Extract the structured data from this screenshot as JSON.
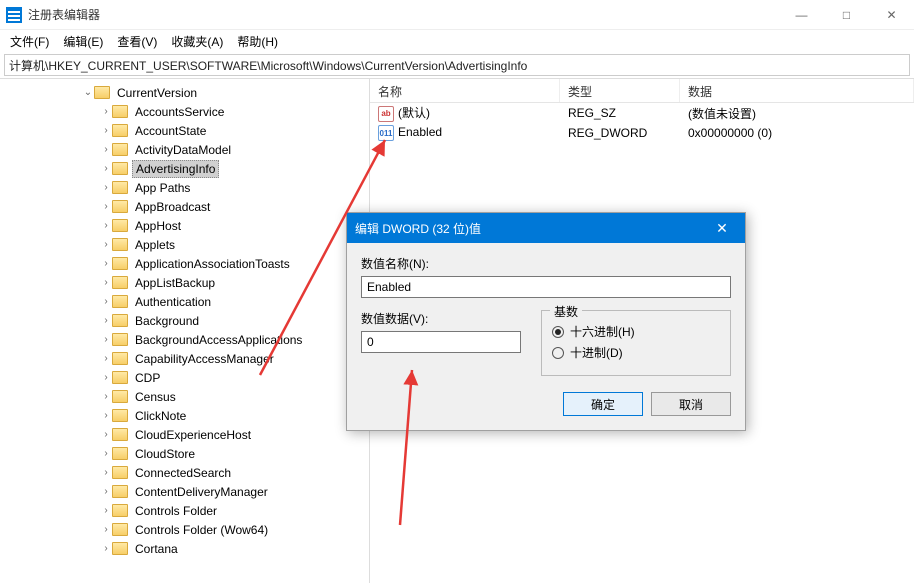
{
  "window": {
    "title": "注册表编辑器"
  },
  "menu": {
    "file": "文件(F)",
    "edit": "编辑(E)",
    "view": "查看(V)",
    "favorites": "收藏夹(A)",
    "help": "帮助(H)"
  },
  "address": "计算机\\HKEY_CURRENT_USER\\SOFTWARE\\Microsoft\\Windows\\CurrentVersion\\AdvertisingInfo",
  "tree": [
    "CurrentVersion",
    "AccountsService",
    "AccountState",
    "ActivityDataModel",
    "AdvertisingInfo",
    "App Paths",
    "AppBroadcast",
    "AppHost",
    "Applets",
    "ApplicationAssociationToasts",
    "AppListBackup",
    "Authentication",
    "Background",
    "BackgroundAccessApplications",
    "CapabilityAccessManager",
    "CDP",
    "Census",
    "ClickNote",
    "CloudExperienceHost",
    "CloudStore",
    "ConnectedSearch",
    "ContentDeliveryManager",
    "Controls Folder",
    "Controls Folder (Wow64)",
    "Cortana"
  ],
  "selected_index": 4,
  "list": {
    "headers": {
      "name": "名称",
      "type": "类型",
      "data": "数据"
    },
    "rows": [
      {
        "icon": "sz",
        "name": "(默认)",
        "type": "REG_SZ",
        "data": "(数值未设置)"
      },
      {
        "icon": "dw",
        "name": "Enabled",
        "type": "REG_DWORD",
        "data": "0x00000000 (0)"
      }
    ]
  },
  "dialog": {
    "title": "编辑 DWORD (32 位)值",
    "name_label": "数值名称(N):",
    "name_value": "Enabled",
    "data_label": "数值数据(V):",
    "data_value": "0",
    "base_label": "基数",
    "hex_label": "十六进制(H)",
    "dec_label": "十进制(D)",
    "ok": "确定",
    "cancel": "取消"
  }
}
